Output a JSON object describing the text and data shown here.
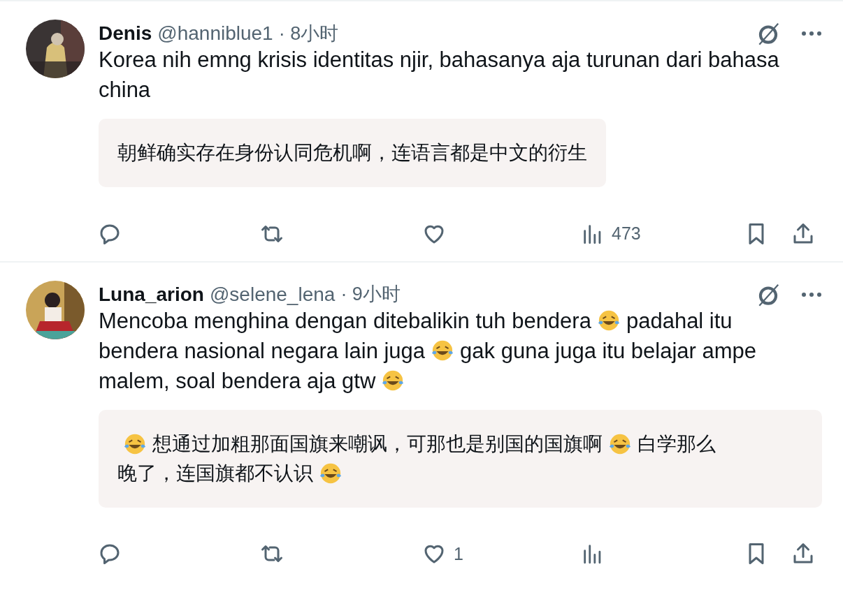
{
  "tweets": [
    {
      "name": "Denis",
      "handle": "@hanniblue1",
      "time": "· 8小时",
      "body": [
        [
          {
            "kind": "text",
            "text": "Korea nih emng krisis identitas njir, bahasanya aja turunan dari bahasa"
          }
        ],
        [
          {
            "kind": "text",
            "text": "china"
          }
        ]
      ],
      "translation": [
        [
          {
            "kind": "text",
            "text": "朝鲜确实存在身份认同危机啊，连语言都是中文的衍生"
          }
        ]
      ],
      "actions": [
        {
          "kind": "reply"
        },
        {
          "kind": "retweet"
        },
        {
          "kind": "like"
        },
        {
          "kind": "views",
          "count": "473"
        },
        {
          "kind": "bookmark"
        },
        {
          "kind": "share"
        }
      ]
    },
    {
      "name": "Luna_arion",
      "handle": "@selene_lena",
      "time": "· 9小时",
      "body": [
        [
          {
            "kind": "text",
            "text": "Mencoba menghina dengan ditebalikin tuh bendera"
          },
          {
            "kind": "emoji"
          },
          {
            "kind": "text",
            "text": "padahal itu"
          }
        ],
        [
          {
            "kind": "text",
            "text": "bendera nasional negara lain juga"
          },
          {
            "kind": "emoji"
          },
          {
            "kind": "text",
            "text": "gak guna juga itu belajar ampe"
          }
        ],
        [
          {
            "kind": "text",
            "text": "malem, soal bendera aja gtw"
          },
          {
            "kind": "emoji"
          }
        ]
      ],
      "translation": [
        [
          {
            "kind": "emoji"
          },
          {
            "kind": "text",
            "text": "想通过加粗那面国旗来嘲讽，可那也是别国的国旗啊"
          },
          {
            "kind": "emoji"
          },
          {
            "kind": "text",
            "text": "白学那么"
          }
        ],
        [
          {
            "kind": "text",
            "text": "晚了，连国旗都不认识"
          },
          {
            "kind": "emoji"
          }
        ]
      ],
      "actions": [
        {
          "kind": "reply"
        },
        {
          "kind": "retweet"
        },
        {
          "kind": "like",
          "count": "1"
        },
        {
          "kind": "views"
        },
        {
          "kind": "bookmark"
        },
        {
          "kind": "share"
        }
      ]
    }
  ]
}
